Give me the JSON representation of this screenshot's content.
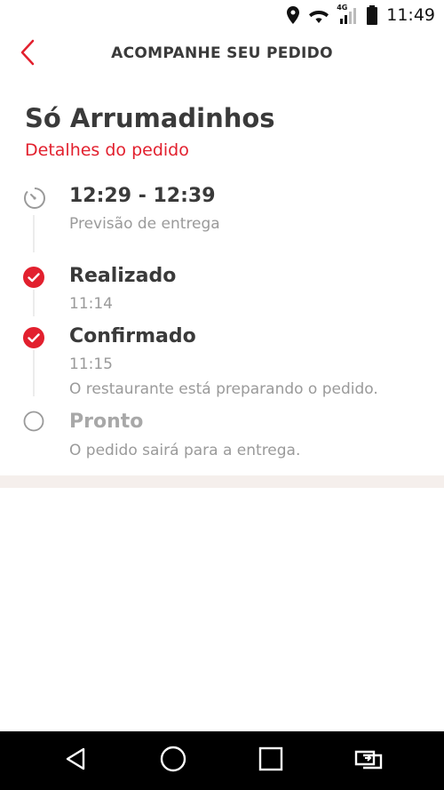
{
  "status_bar": {
    "time": "11:49",
    "network": "4G",
    "icons": [
      "location-icon",
      "wifi-icon",
      "cell-signal-icon",
      "battery-icon"
    ]
  },
  "header": {
    "title": "ACOMPANHE SEU PEDIDO",
    "back_icon": "chevron-left-icon"
  },
  "restaurant": {
    "name": "Só Arrumadinhos",
    "details_link": "Detalhes do pedido"
  },
  "timeline": {
    "eta": {
      "time_range": "12:29 - 12:39",
      "label": "Previsão de entrega",
      "icon": "clock-icon"
    },
    "steps": [
      {
        "title": "Realizado",
        "time": "11:14",
        "description": "",
        "status": "done"
      },
      {
        "title": "Confirmado",
        "time": "11:15",
        "description": "O restaurante está preparando o pedido.",
        "status": "done"
      },
      {
        "title": "Pronto",
        "time": "",
        "description": "O pedido sairá para a entrega.",
        "status": "pending"
      }
    ]
  },
  "colors": {
    "accent": "#e2202e",
    "text": "#3a3a3a",
    "muted": "#9a9a9a",
    "band": "#f5efec"
  },
  "nav_bar": {
    "icons": [
      "back-triangle-icon",
      "home-circle-icon",
      "recents-square-icon",
      "switch-apps-icon"
    ]
  }
}
